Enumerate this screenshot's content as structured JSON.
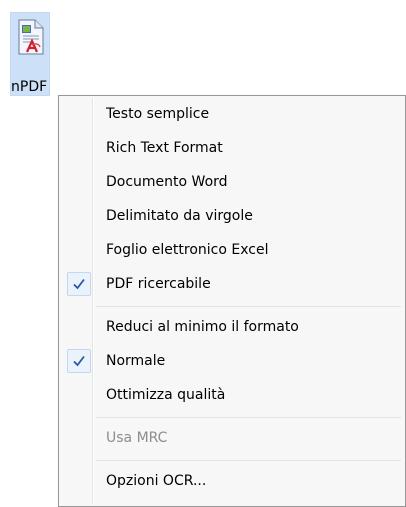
{
  "desktop": {
    "icon": {
      "label": "nPDF",
      "icon_name": "pdf-document-icon"
    }
  },
  "menu": {
    "groups": [
      [
        {
          "label": "Testo semplice",
          "checked": false,
          "enabled": true
        },
        {
          "label": "Rich Text Format",
          "checked": false,
          "enabled": true
        },
        {
          "label": "Documento Word",
          "checked": false,
          "enabled": true
        },
        {
          "label": "Delimitato da virgole",
          "checked": false,
          "enabled": true
        },
        {
          "label": "Foglio elettronico Excel",
          "checked": false,
          "enabled": true
        },
        {
          "label": "PDF ricercabile",
          "checked": true,
          "enabled": true
        }
      ],
      [
        {
          "label": "Reduci al minimo il formato",
          "checked": false,
          "enabled": true
        },
        {
          "label": "Normale",
          "checked": true,
          "enabled": true
        },
        {
          "label": "Ottimizza qualità",
          "checked": false,
          "enabled": true
        }
      ],
      [
        {
          "label": "Usa MRC",
          "checked": false,
          "enabled": false
        }
      ],
      [
        {
          "label": "Opzioni OCR...",
          "checked": false,
          "enabled": true
        }
      ]
    ],
    "colors": {
      "check": "#2b5b9e",
      "disabled_text": "#8d8d8d"
    }
  }
}
